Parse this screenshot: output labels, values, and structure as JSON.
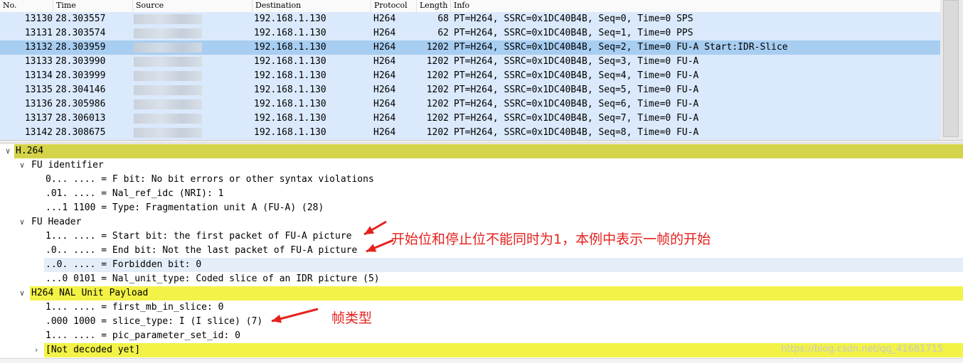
{
  "columns": [
    "No.",
    "Time",
    "Source",
    "Destination",
    "Protocol",
    "Length",
    "Info"
  ],
  "packets": [
    {
      "no": "13130",
      "time": "28.303557",
      "destination": "192.168.1.130",
      "protocol": "H264",
      "length": "68",
      "info": "PT=H264, SSRC=0x1DC40B4B, Seq=0, Time=0 SPS",
      "selected": false
    },
    {
      "no": "13131",
      "time": "28.303574",
      "destination": "192.168.1.130",
      "protocol": "H264",
      "length": "62",
      "info": "PT=H264, SSRC=0x1DC40B4B, Seq=1, Time=0 PPS",
      "selected": false
    },
    {
      "no": "13132",
      "time": "28.303959",
      "destination": "192.168.1.130",
      "protocol": "H264",
      "length": "1202",
      "info": "PT=H264, SSRC=0x1DC40B4B, Seq=2, Time=0 FU-A Start:IDR-Slice",
      "selected": true
    },
    {
      "no": "13133",
      "time": "28.303990",
      "destination": "192.168.1.130",
      "protocol": "H264",
      "length": "1202",
      "info": "PT=H264, SSRC=0x1DC40B4B, Seq=3, Time=0 FU-A",
      "selected": false
    },
    {
      "no": "13134",
      "time": "28.303999",
      "destination": "192.168.1.130",
      "protocol": "H264",
      "length": "1202",
      "info": "PT=H264, SSRC=0x1DC40B4B, Seq=4, Time=0 FU-A",
      "selected": false
    },
    {
      "no": "13135",
      "time": "28.304146",
      "destination": "192.168.1.130",
      "protocol": "H264",
      "length": "1202",
      "info": "PT=H264, SSRC=0x1DC40B4B, Seq=5, Time=0 FU-A",
      "selected": false
    },
    {
      "no": "13136",
      "time": "28.305986",
      "destination": "192.168.1.130",
      "protocol": "H264",
      "length": "1202",
      "info": "PT=H264, SSRC=0x1DC40B4B, Seq=6, Time=0 FU-A",
      "selected": false
    },
    {
      "no": "13137",
      "time": "28.306013",
      "destination": "192.168.1.130",
      "protocol": "H264",
      "length": "1202",
      "info": "PT=H264, SSRC=0x1DC40B4B, Seq=7, Time=0 FU-A",
      "selected": false
    },
    {
      "no": "13142",
      "time": "28.308675",
      "destination": "192.168.1.130",
      "protocol": "H264",
      "length": "1202",
      "info": "PT=H264, SSRC=0x1DC40B4B, Seq=8, Time=0 FU-A",
      "selected": false
    }
  ],
  "tree": [
    {
      "text": "H.264",
      "arrow": "chevron-down-icon",
      "highlight": "yellow-dark"
    },
    {
      "text": "FU identifier",
      "arrow": "chevron-down-icon",
      "highlight": ""
    },
    {
      "text": "0... .... = F bit: No bit errors or other syntax violations",
      "arrow": "",
      "highlight": ""
    },
    {
      "text": ".01. .... = Nal_ref_idc (NRI): 1",
      "arrow": "",
      "highlight": ""
    },
    {
      "text": "...1 1100 = Type: Fragmentation unit A (FU-A) (28)",
      "arrow": "",
      "highlight": ""
    },
    {
      "text": "FU Header",
      "arrow": "chevron-down-icon",
      "highlight": ""
    },
    {
      "text": "1... .... = Start bit: the first packet of FU-A picture",
      "arrow": "",
      "highlight": ""
    },
    {
      "text": ".0.. .... = End bit: Not the last packet of FU-A picture",
      "arrow": "",
      "highlight": ""
    },
    {
      "text": "..0. .... = Forbidden bit: 0",
      "arrow": "",
      "highlight": "blue"
    },
    {
      "text": "...0 0101 = Nal_unit_type: Coded slice of an IDR picture (5)",
      "arrow": "",
      "highlight": ""
    },
    {
      "text": "H264 NAL Unit Payload",
      "arrow": "chevron-down-icon",
      "highlight": "yellow"
    },
    {
      "text": "1... .... = first_mb_in_slice: 0",
      "arrow": "",
      "highlight": ""
    },
    {
      "text": ".000 1000 = slice_type: I (I slice) (7)",
      "arrow": "",
      "highlight": ""
    },
    {
      "text": "1... .... = pic_parameter_set_id: 0",
      "arrow": "",
      "highlight": ""
    },
    {
      "text": "[Not decoded yet]",
      "arrow": "chevron-right-icon",
      "highlight": "yellow"
    }
  ],
  "annotations": {
    "start_end_note": "开始位和停止位不能同时为1，本例中表示一帧的开始",
    "frame_type_note": "帧类型",
    "color": "#e5211d"
  },
  "watermark": "https://blog.csdn.net/qq_41681715",
  "colors": {
    "row_bg": "#dae9fb",
    "row_selected": "#a7cdf1",
    "protocol_highlight": "#d4d34a",
    "payload_highlight": "#f2f247",
    "field_highlight": "#e4eef9"
  }
}
